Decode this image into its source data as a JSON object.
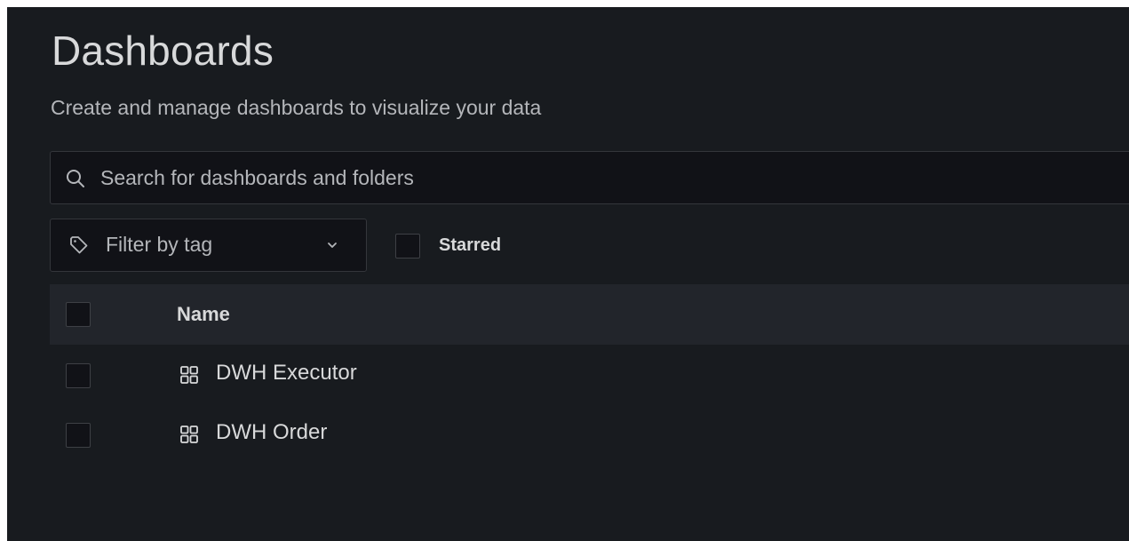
{
  "page": {
    "title": "Dashboards",
    "subtitle": "Create and manage dashboards to visualize your data"
  },
  "search": {
    "placeholder": "Search for dashboards and folders",
    "value": ""
  },
  "filters": {
    "tag_filter_label": "Filter by tag",
    "starred_label": "Starred",
    "starred_checked": false
  },
  "table": {
    "columns": [
      "Name"
    ],
    "rows": [
      {
        "name": "DWH Executor",
        "icon": "apps-icon",
        "checked": false
      },
      {
        "name": "DWH Order",
        "icon": "apps-icon",
        "checked": false
      }
    ]
  },
  "colors": {
    "background": "#181b1f",
    "input_background": "#111217",
    "header_background": "#22252b",
    "text_primary": "#d8d9da",
    "text_secondary": "#b4b6ba"
  }
}
